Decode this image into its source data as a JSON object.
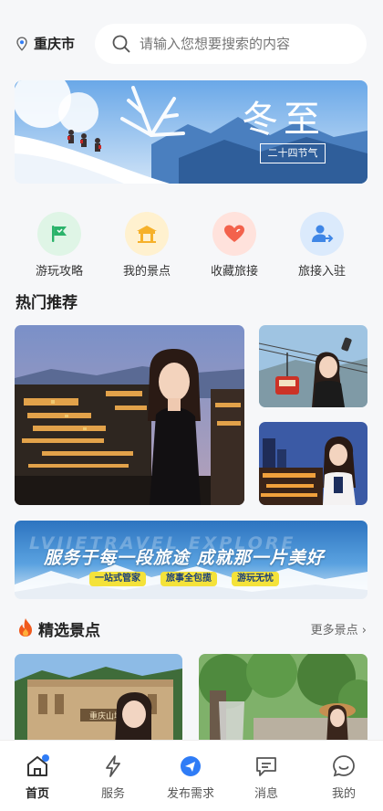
{
  "header": {
    "city": "重庆市",
    "search_placeholder": "请输入您想要搜索的内容"
  },
  "banner": {
    "title": "冬至",
    "subtitle": "二十四节气"
  },
  "quick_entries": [
    {
      "label": "游玩攻略",
      "icon": "flag-icon"
    },
    {
      "label": "我的景点",
      "icon": "pavilion-icon"
    },
    {
      "label": "收藏旅接",
      "icon": "heart-icon"
    },
    {
      "label": "旅接入驻",
      "icon": "user-join-icon"
    }
  ],
  "hot": {
    "title": "热门推荐"
  },
  "promo": {
    "bg_text": "LVJIETRAVEL EXPLORE",
    "slogan": "服务于每一段旅途 成就那一片美好",
    "chips": [
      "一站式管家",
      "旅事全包揽",
      "游玩无忧"
    ]
  },
  "featured": {
    "title": "精选景点",
    "more": "更多景点 ›",
    "sign_text": "重庆山城"
  },
  "tabbar": {
    "tabs": [
      {
        "label": "首页",
        "icon": "home-icon",
        "active": true
      },
      {
        "label": "服务",
        "icon": "lightning-icon",
        "active": false
      },
      {
        "label": "发布需求",
        "icon": "send-icon",
        "active": false
      },
      {
        "label": "消息",
        "icon": "message-icon",
        "active": false
      },
      {
        "label": "我的",
        "icon": "smile-icon",
        "active": false
      }
    ]
  },
  "colors": {
    "accent": "#2f7cf6",
    "background": "#f6f7f9"
  }
}
